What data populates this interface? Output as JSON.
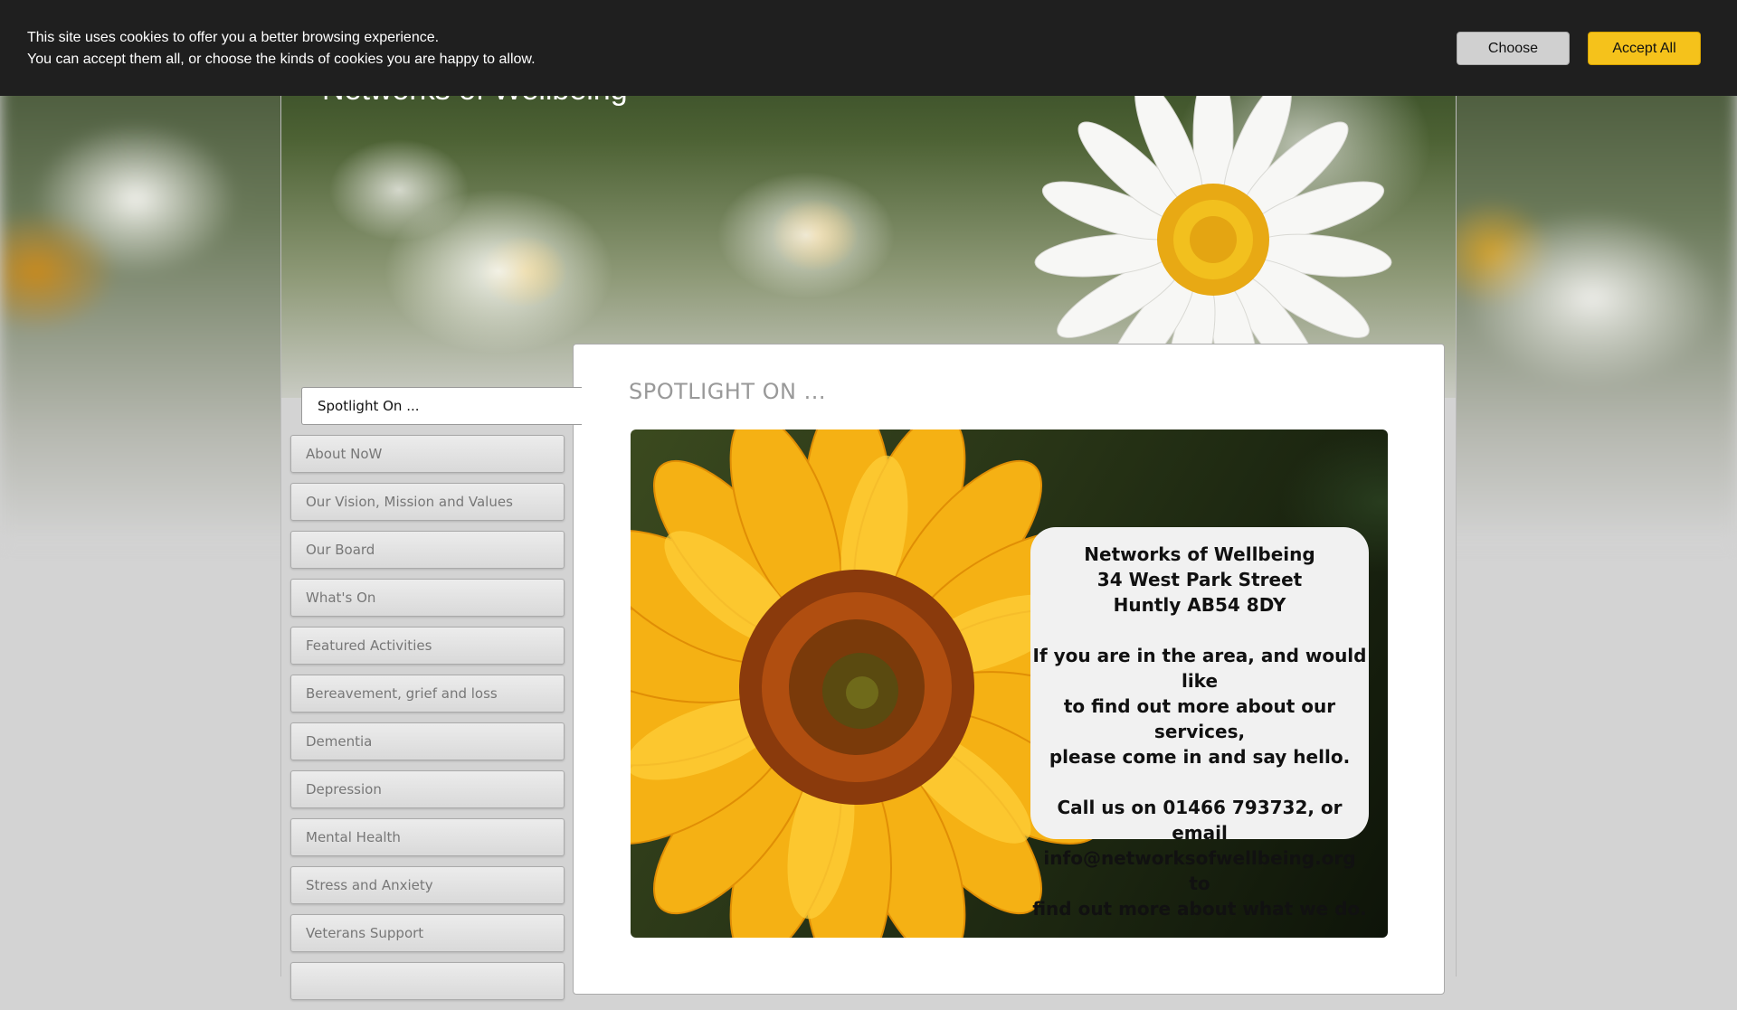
{
  "cookie_banner": {
    "line1": "This site uses cookies to offer you a better browsing experience.",
    "line2": "You can accept them all, or choose the kinds of cookies you are happy to allow.",
    "choose_label": "Choose",
    "accept_all_label": "Accept All",
    "accept_color": "#f5c21b"
  },
  "site": {
    "title": "Networks of Wellbeing"
  },
  "sidebar": {
    "current": "Spotlight On ...",
    "items": [
      {
        "label": "About NoW"
      },
      {
        "label": "Our Vision, Mission and Values"
      },
      {
        "label": "Our Board"
      },
      {
        "label": "What's On"
      },
      {
        "label": "Featured Activities"
      },
      {
        "label": "Bereavement, grief and loss"
      },
      {
        "label": "Dementia"
      },
      {
        "label": "Depression"
      },
      {
        "label": "Mental Health"
      },
      {
        "label": "Stress and Anxiety"
      },
      {
        "label": "Veterans Support"
      }
    ]
  },
  "main": {
    "title": "SPOTLIGHT ON ...",
    "card": {
      "org": "Networks of Wellbeing",
      "street": "34 West Park Street",
      "town": "Huntly AB54 8DY",
      "invite_1": "If you are in the area, and would like",
      "invite_2": "to find out more about our services,",
      "invite_3": "please come in and say hello.",
      "call_1": "Call us on 01466 793732, or email",
      "call_2": "info@networksofwellbeing.org to",
      "call_3": "find out more about what we do."
    }
  }
}
